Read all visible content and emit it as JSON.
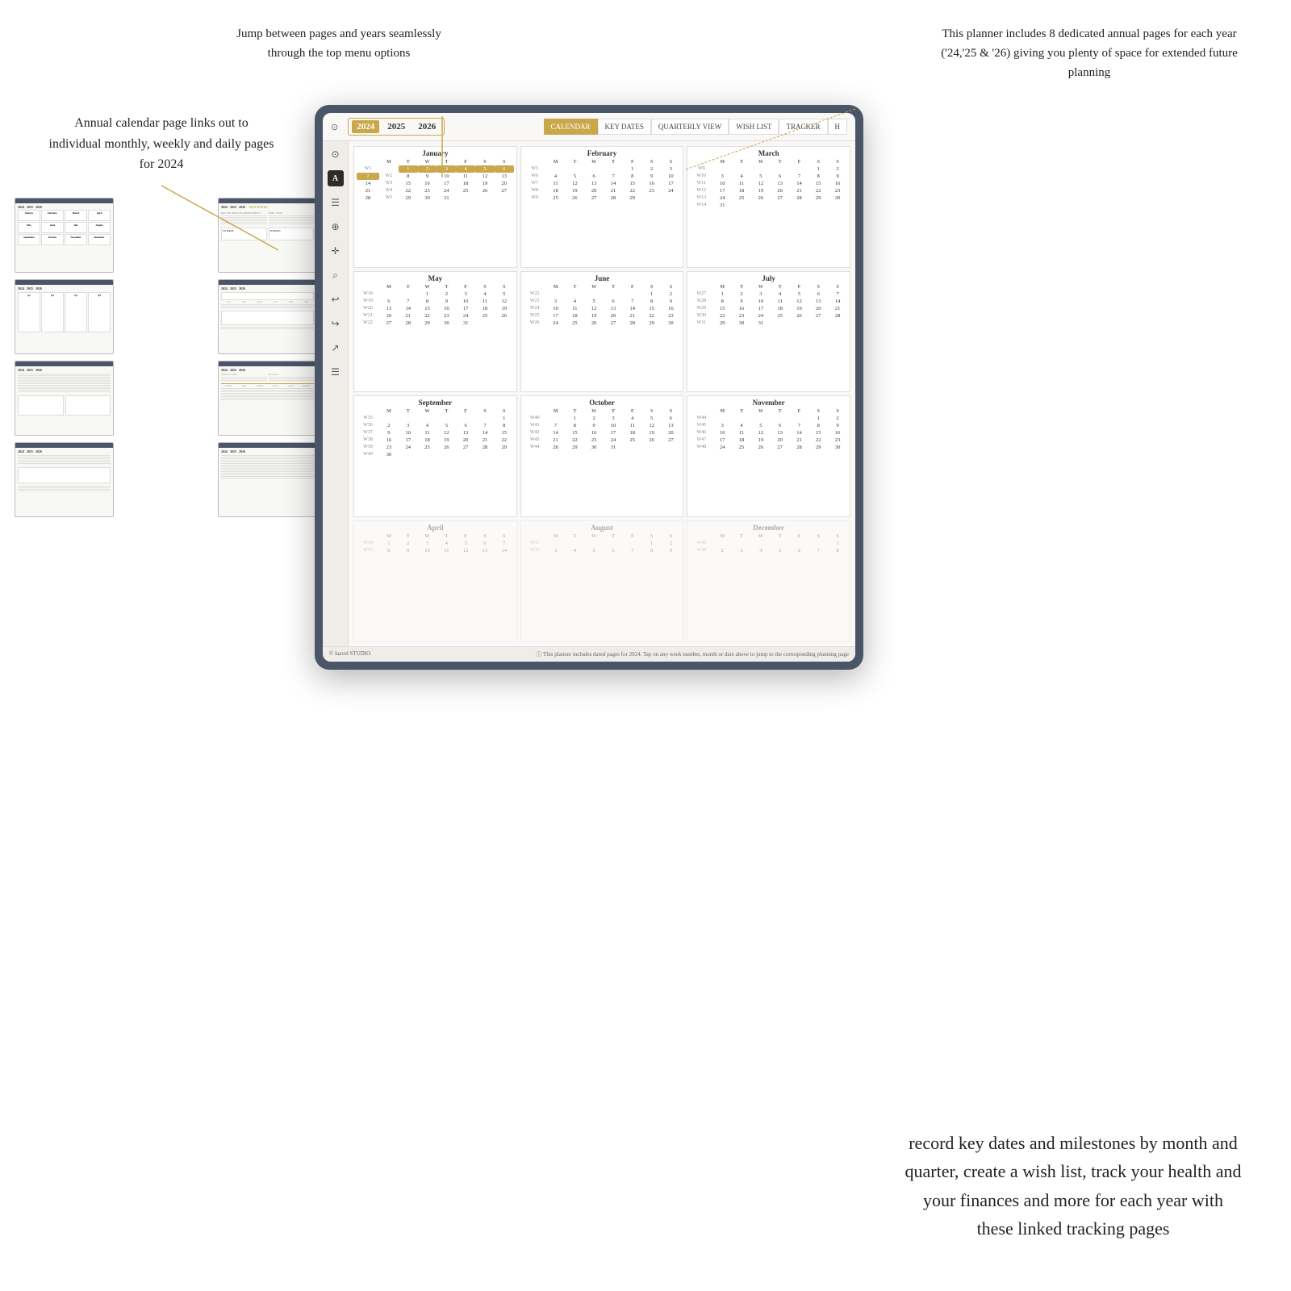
{
  "annotations": {
    "center_top": "Jump between pages and years seamlessly through the top menu options",
    "right_top": "This planner includes 8 dedicated annual pages for each year ('24,'25 & '26) giving you plenty of space for extended future planning",
    "left_top": "Annual calendar page links out to individual monthly, weekly and daily pages for 2024"
  },
  "tablet": {
    "years": [
      "2024",
      "2025",
      "2026"
    ],
    "active_year": "2024",
    "menu_tabs": [
      "CALENDAR",
      "KEY DATES",
      "QUARTERLY VIEW",
      "WISH LIST",
      "TRACKER",
      "H"
    ],
    "active_menu": "CALENDAR",
    "sidebar_icons": [
      "⊙",
      "A",
      "☰",
      "⊕",
      "⊕",
      "↩",
      "↪",
      "↗",
      "☰"
    ],
    "months": [
      {
        "name": "January",
        "weeks": [
          {
            "wk": "W1",
            "days": [
              "",
              "",
              "1",
              "2",
              "3",
              "4",
              "5",
              "6",
              "7"
            ]
          },
          {
            "wk": "W2",
            "days": [
              "8",
              "9",
              "10",
              "11",
              "12",
              "13",
              "14"
            ]
          },
          {
            "wk": "W3",
            "days": [
              "15",
              "16",
              "17",
              "18",
              "19",
              "20",
              "21"
            ]
          },
          {
            "wk": "W4",
            "days": [
              "22",
              "23",
              "24",
              "25",
              "26",
              "27",
              "28"
            ]
          },
          {
            "wk": "W5",
            "days": [
              "29",
              "30",
              "31",
              "",
              "",
              "",
              ""
            ]
          }
        ],
        "highlighted": [
          "1",
          "2",
          "3",
          "4",
          "5",
          "6",
          "7"
        ]
      },
      {
        "name": "February",
        "weeks": [
          {
            "wk": "W5",
            "days": [
              "",
              "",
              "",
              "",
              "1",
              "2",
              "3",
              "4"
            ]
          },
          {
            "wk": "W6",
            "days": [
              "5",
              "6",
              "7",
              "8",
              "9",
              "10",
              "11"
            ]
          },
          {
            "wk": "W7",
            "days": [
              "12",
              "13",
              "14",
              "15",
              "16",
              "17",
              "18"
            ]
          },
          {
            "wk": "W8",
            "days": [
              "19",
              "20",
              "21",
              "22",
              "23",
              "24",
              "25"
            ]
          },
          {
            "wk": "W9",
            "days": [
              "26",
              "27",
              "28",
              "29",
              "",
              "",
              ""
            ]
          }
        ]
      },
      {
        "name": "March",
        "weeks": [
          {
            "wk": "W9",
            "days": [
              "",
              "",
              "",
              "",
              "",
              "1",
              "2",
              "3"
            ]
          },
          {
            "wk": "W10",
            "days": [
              "4",
              "5",
              "6",
              "7",
              "8",
              "9",
              "10"
            ]
          },
          {
            "wk": "W11",
            "days": [
              "11",
              "12",
              "13",
              "14",
              "15",
              "16",
              "17"
            ]
          },
          {
            "wk": "W12",
            "days": [
              "18",
              "19",
              "20",
              "21",
              "22",
              "23",
              "24"
            ]
          },
          {
            "wk": "W13",
            "days": [
              "25",
              "26",
              "27",
              "28",
              "29",
              "30",
              "31"
            ]
          }
        ]
      },
      {
        "name": "May",
        "weeks": [
          {
            "wk": "W18",
            "days": [
              "",
              "",
              "1",
              "2",
              "3",
              "4",
              "5"
            ]
          },
          {
            "wk": "W19",
            "days": [
              "6",
              "7",
              "8",
              "9",
              "10",
              "11",
              "12"
            ]
          },
          {
            "wk": "W20",
            "days": [
              "13",
              "14",
              "15",
              "16",
              "17",
              "18",
              "19"
            ]
          },
          {
            "wk": "W21",
            "days": [
              "20",
              "21",
              "22",
              "23",
              "24",
              "25",
              "26"
            ]
          },
          {
            "wk": "W22",
            "days": [
              "27",
              "28",
              "29",
              "30",
              "31",
              "",
              ""
            ]
          }
        ]
      },
      {
        "name": "June",
        "weeks": [
          {
            "wk": "W22",
            "days": [
              "",
              "",
              "",
              "",
              "",
              "",
              "1",
              "2"
            ]
          },
          {
            "wk": "W23",
            "days": [
              "3",
              "4",
              "5",
              "6",
              "7",
              "8",
              "9"
            ]
          },
          {
            "wk": "W24",
            "days": [
              "10",
              "11",
              "12",
              "13",
              "14",
              "15",
              "16"
            ]
          },
          {
            "wk": "W25",
            "days": [
              "17",
              "18",
              "19",
              "20",
              "21",
              "22",
              "23"
            ]
          },
          {
            "wk": "W26",
            "days": [
              "24",
              "25",
              "26",
              "27",
              "28",
              "29",
              "30"
            ]
          }
        ]
      },
      {
        "name": "July",
        "weeks": [
          {
            "wk": "W27",
            "days": [
              "1",
              "2",
              "3",
              "4",
              "5",
              "6",
              "7"
            ]
          },
          {
            "wk": "W28",
            "days": [
              "8",
              "9",
              "10",
              "11",
              "12",
              "13",
              "14"
            ]
          },
          {
            "wk": "W29",
            "days": [
              "15",
              "16",
              "17",
              "18",
              "19",
              "20",
              "21"
            ]
          },
          {
            "wk": "W30",
            "days": [
              "22",
              "23",
              "24",
              "25",
              "26",
              "27",
              "28"
            ]
          },
          {
            "wk": "W31",
            "days": [
              "29",
              "30",
              "31",
              "",
              "",
              "",
              ""
            ]
          }
        ]
      },
      {
        "name": "September",
        "weeks": [
          {
            "wk": "W35",
            "days": [
              "",
              "",
              "",
              "",
              "",
              "",
              "",
              "1"
            ]
          },
          {
            "wk": "W36",
            "days": [
              "2",
              "3",
              "4",
              "5",
              "6",
              "7",
              "8"
            ]
          },
          {
            "wk": "W37",
            "days": [
              "9",
              "10",
              "11",
              "12",
              "13",
              "14",
              "15"
            ]
          },
          {
            "wk": "W38",
            "days": [
              "16",
              "17",
              "18",
              "19",
              "20",
              "21",
              "22"
            ]
          },
          {
            "wk": "W39",
            "days": [
              "23",
              "24",
              "25",
              "26",
              "27",
              "28",
              "29"
            ]
          },
          {
            "wk": "W40",
            "days": [
              "30",
              "",
              "",
              "",
              "",
              "",
              ""
            ]
          }
        ]
      },
      {
        "name": "October",
        "weeks": [
          {
            "wk": "W40",
            "days": [
              "",
              "1",
              "2",
              "3",
              "4",
              "5",
              "6"
            ]
          },
          {
            "wk": "W41",
            "days": [
              "7",
              "8",
              "9",
              "10",
              "11",
              "12",
              "13"
            ]
          },
          {
            "wk": "W42",
            "days": [
              "14",
              "15",
              "16",
              "17",
              "18",
              "19",
              "20"
            ]
          },
          {
            "wk": "W43",
            "days": [
              "21",
              "22",
              "23",
              "24",
              "25",
              "26",
              "27"
            ]
          },
          {
            "wk": "W44",
            "days": [
              "28",
              "29",
              "30",
              "31",
              "",
              "",
              ""
            ]
          }
        ]
      },
      {
        "name": "November",
        "weeks": [
          {
            "wk": "W44",
            "days": [
              "",
              "",
              "",
              "",
              "",
              "1",
              "2",
              "3"
            ]
          },
          {
            "wk": "W45",
            "days": [
              "4",
              "5",
              "6",
              "7",
              "8",
              "9",
              "10"
            ]
          },
          {
            "wk": "W46",
            "days": [
              "11",
              "12",
              "13",
              "14",
              "15",
              "16",
              "17"
            ]
          },
          {
            "wk": "W47",
            "days": [
              "18",
              "19",
              "20",
              "21",
              "22",
              "23",
              "24"
            ]
          },
          {
            "wk": "W48",
            "days": [
              "25",
              "26",
              "27",
              "28",
              "29",
              "30",
              ""
            ]
          }
        ]
      }
    ],
    "footer_left": "© laavel STUDIO",
    "footer_right": "ⓘ This planner includes dated pages for 2024. Tap on any week number, month or date above to jump to the corresponding planning page"
  },
  "bottom_text": "record key dates and milestones by month and quarter, create a wish list, track your health and your finances and more for each year with these linked tracking pages",
  "colors": {
    "gold": "#c9a84c",
    "dark": "#4a5568",
    "bg": "#f9f8f6"
  }
}
